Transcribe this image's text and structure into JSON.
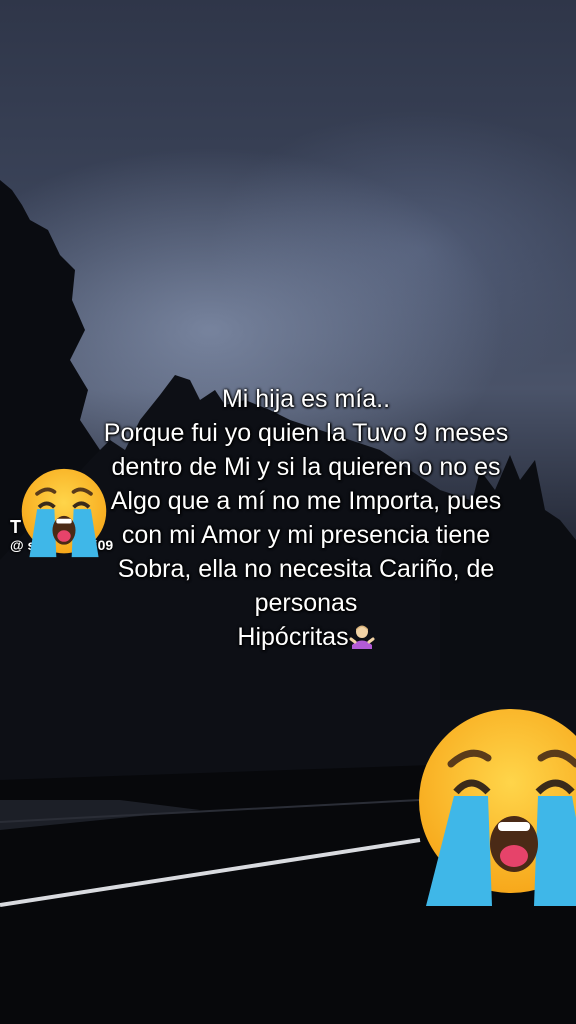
{
  "caption": {
    "text": "Mi hija es mía..\nPorque fui yo quien la Tuvo 9 meses dentro de Mi y si la quieren o no es Algo que a mí no me Importa, pues con mi Amor y mi presencia tiene Sobra, ella no necesita Cariño, de personas\nHipócritas",
    "trailing_emoji": "person-shrugging-emoji"
  },
  "watermark": {
    "name": "T",
    "handle": "@ s        antamari09"
  },
  "stickers": [
    "crying-face-emoji",
    "crying-face-emoji"
  ],
  "colors": {
    "sky": "#3d465c",
    "text": "#ffffff"
  }
}
